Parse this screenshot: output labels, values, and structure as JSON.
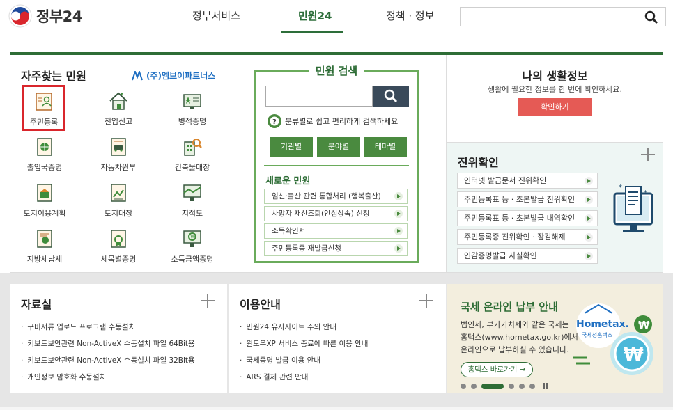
{
  "header": {
    "logo_text": "정부24",
    "nav": [
      "정부서비스",
      "민원24",
      "정책 · 정보"
    ],
    "search_placeholder": ""
  },
  "favorites": {
    "title": "자주찾는 민원",
    "partner": "(주)엠브이파트너스",
    "items": [
      {
        "label": "주민등록",
        "icon": "resident-registration-icon"
      },
      {
        "label": "전입신고",
        "icon": "house-move-icon"
      },
      {
        "label": "병적증명",
        "icon": "military-record-icon"
      },
      {
        "label": "출입국증명",
        "icon": "globe-document-icon"
      },
      {
        "label": "자동차원부",
        "icon": "car-document-icon"
      },
      {
        "label": "건축물대장",
        "icon": "building-search-icon"
      },
      {
        "label": "토지이용계획",
        "icon": "land-plan-icon"
      },
      {
        "label": "토지대장",
        "icon": "land-register-icon"
      },
      {
        "label": "지적도",
        "icon": "cadastral-map-icon"
      },
      {
        "label": "지방세납세",
        "icon": "local-tax-icon"
      },
      {
        "label": "세목별증명",
        "icon": "tax-certificate-icon"
      },
      {
        "label": "소득금액증명",
        "icon": "income-certificate-icon"
      }
    ]
  },
  "civil_search": {
    "title": "민원 검색",
    "help": "분류별로 쉽고 편리하게 검색하세요",
    "categories": [
      "기관별",
      "분야별",
      "테마별"
    ],
    "new_title": "새로운 민원",
    "new_items": [
      "임신·출산 관련 통합처리 (행복출산)",
      "사망자 재산조회(안심상속) 신청",
      "소득확인서",
      "주민등록증 재발급신청"
    ]
  },
  "life_info": {
    "title": "나의 생활정보",
    "desc": "생활에 필요한 정보를 한 번에 확인하세요.",
    "button": "확인하기"
  },
  "verify": {
    "title": "진위확인",
    "items": [
      "인터넷 발급문서 진위확인",
      "주민등록표 등 · 초본발급 진위확인",
      "주민등록표 등 · 초본발급 내역확인",
      "주민등록증 진위확인 · 잠김해제",
      "인감증명발급 사실확인"
    ]
  },
  "resources": {
    "title": "자료실",
    "items": [
      "구비서류 업로드 프로그램 수동설치",
      "키보드보안관련 Non-ActiveX 수동설치 파일 64Bit용",
      "키보드보안관련 Non-ActiveX 수동설치 파일 32Bit용",
      "개인정보 암호화 수동설치"
    ]
  },
  "guide": {
    "title": "이용안내",
    "items": [
      "민원24 유사사이트 주의 안내",
      "윈도우XP 서비스 종료에 따른 이용 안내",
      "국세증명 발급 이용 안내",
      "ARS 결제 관련 안내"
    ]
  },
  "tax": {
    "title": "국세 온라인 납부 안내",
    "desc_lines": [
      "법인세, 부가가치세와 같은 국세는",
      "홈택스(www.hometax.go.kr)에서",
      "온라인으로 납부하실 수 있습니다."
    ],
    "button": "홈택스 바로가기 →",
    "hometax_logo": "Hometax.",
    "hometax_sub": "국세청홈택스",
    "won_symbol": "₩"
  },
  "colors": {
    "brand_green": "#2e6d36",
    "accent_red": "#e55a55",
    "highlight_red": "#d9262c"
  }
}
